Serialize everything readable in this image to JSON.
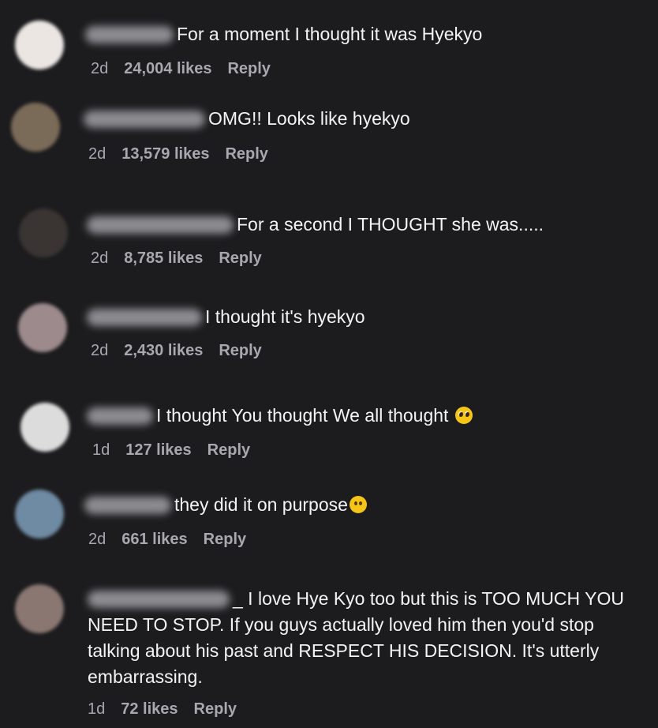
{
  "comments": [
    {
      "text": "For a moment I thought it was Hyekyo",
      "time": "2d",
      "likes": "24,004 likes",
      "reply": "Reply",
      "avatar_color": "#ece6e3"
    },
    {
      "text": "OMG!! Looks like hyekyo",
      "time": "2d",
      "likes": "13,579 likes",
      "reply": "Reply",
      "avatar_color": "#7a6a58"
    },
    {
      "text": "For a second I THOUGHT she was.....",
      "time": "2d",
      "likes": "8,785 likes",
      "reply": "Reply",
      "avatar_color": "#3a3533"
    },
    {
      "text": "I thought it's hyekyo",
      "time": "2d",
      "likes": "2,430 likes",
      "reply": "Reply",
      "avatar_color": "#9c8a8c"
    },
    {
      "text": "I thought You thought We all thought",
      "time": "1d",
      "likes": "127 likes",
      "reply": "Reply",
      "avatar_color": "#dcdcdc",
      "emoji": "pleading-face-emoji"
    },
    {
      "text": "they did it on purpose",
      "time": "2d",
      "likes": "661 likes",
      "reply": "Reply",
      "avatar_color": "#6f8aa3",
      "emoji": "slightly-smiling-face-emoji"
    },
    {
      "text": "_ I love Hye Kyo too but this is TOO MUCH YOU NEED TO STOP. If you guys actually loved him then you'd stop talking about his past and RESPECT HIS DECISION. It's utterly embarrassing.",
      "time": "1d",
      "likes": "72 likes",
      "reply": "Reply",
      "avatar_color": "#8a7772"
    }
  ],
  "colors": {
    "background": "#1c1c1e",
    "text": "#f4f4f4",
    "meta": "#a8a8ad"
  }
}
